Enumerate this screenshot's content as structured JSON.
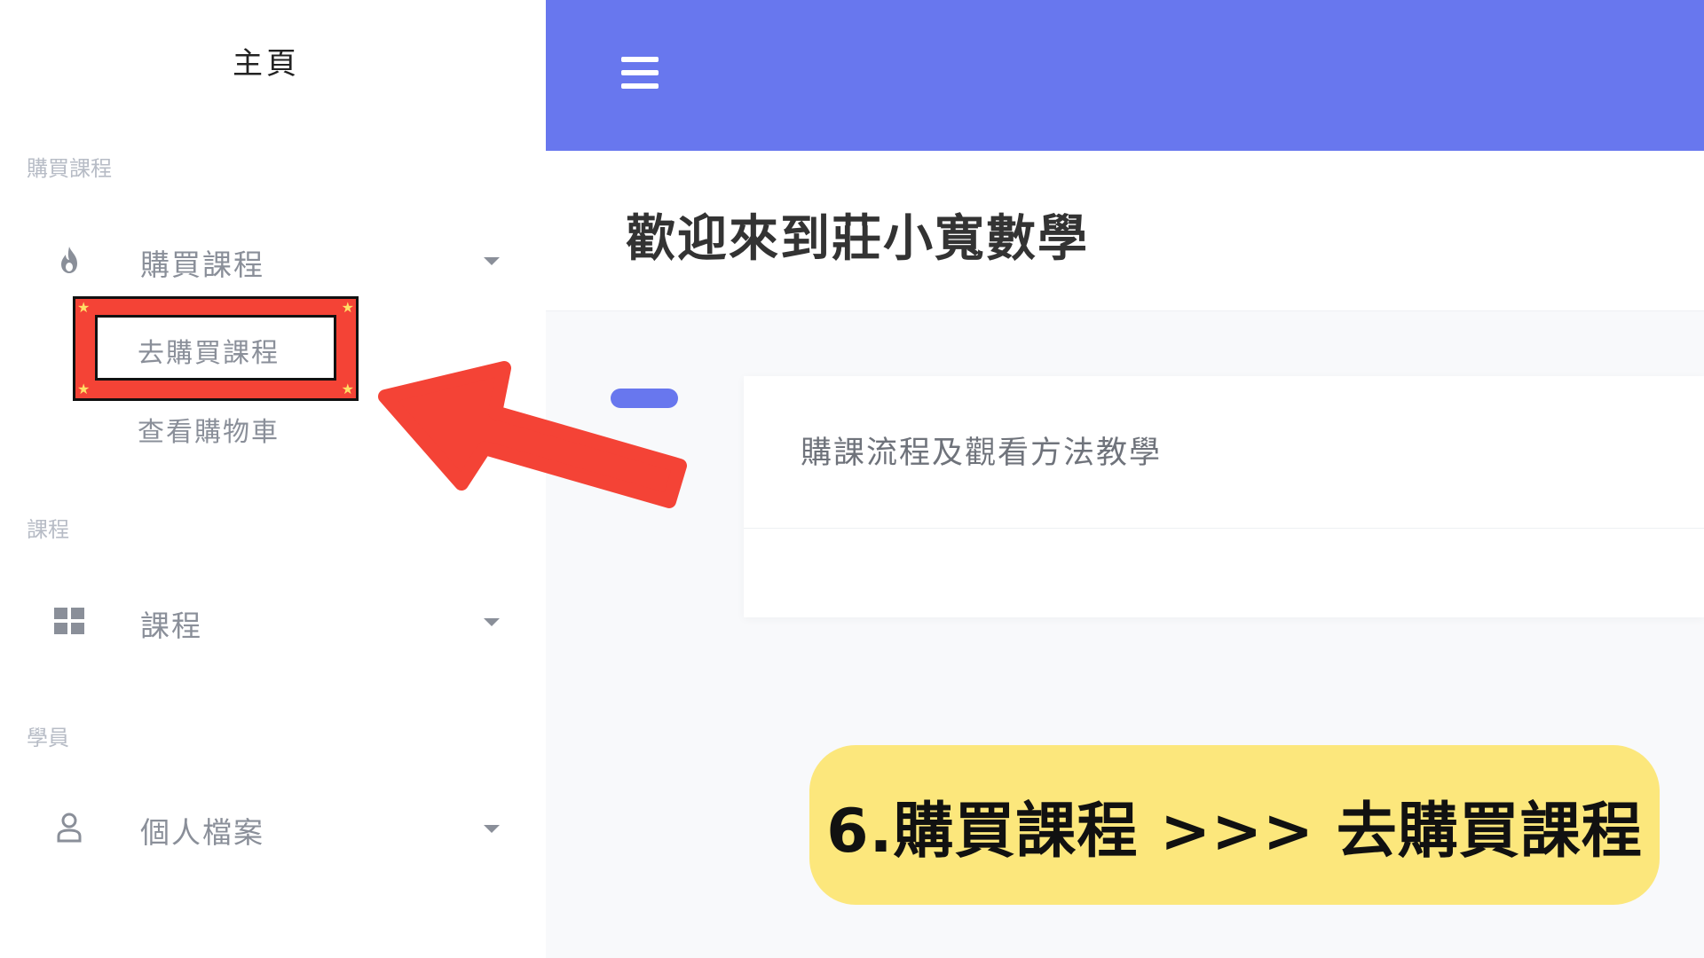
{
  "app": {
    "brand": "主頁"
  },
  "sidebar": {
    "sections": [
      {
        "heading": "購買課程",
        "item": {
          "label": "購買課程",
          "icon": "flame-icon",
          "subitems": [
            "去購買課程",
            "查看購物車"
          ]
        }
      },
      {
        "heading": "課程",
        "item": {
          "label": "課程",
          "icon": "grid-icon"
        }
      },
      {
        "heading": "學員",
        "item": {
          "label": "個人檔案",
          "icon": "user-icon"
        }
      }
    ]
  },
  "topbar": {
    "menu_icon": "hamburger-icon",
    "color": "#6877ee"
  },
  "main": {
    "title": "歡迎來到莊小寬數學",
    "card": {
      "title": "購課流程及觀看方法教學"
    }
  },
  "annotation": {
    "caption": "6.購買課程 >>> 去購買課程",
    "highlight_color": "#f44336",
    "caption_bg": "#fce77c"
  }
}
